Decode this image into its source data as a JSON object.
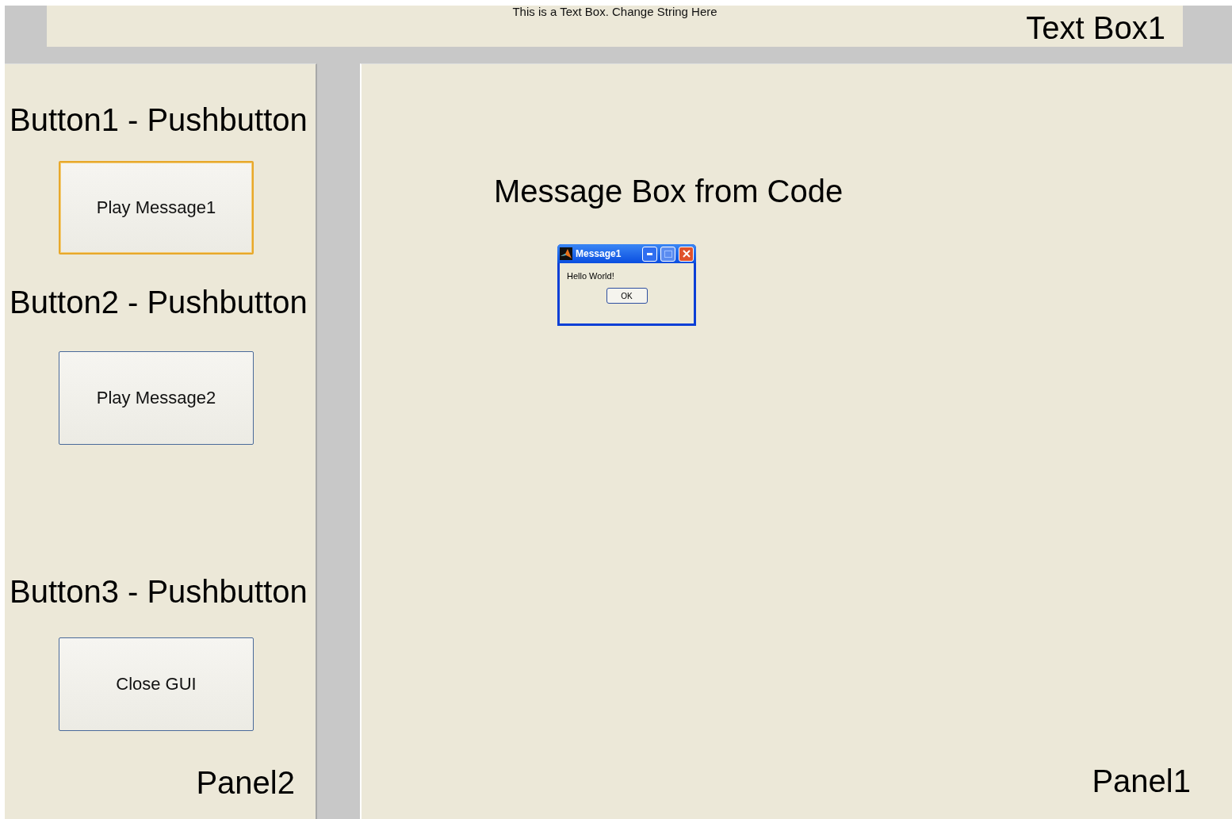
{
  "text_box": {
    "string": "This is a Text Box.  Change String Here",
    "annotation": "Text Box1"
  },
  "left_panel": {
    "annotation": "Panel2",
    "buttons": [
      {
        "annotation": "Button1 - Pushbutton",
        "label": "Play Message1",
        "focused": true
      },
      {
        "annotation": "Button2 - Pushbutton",
        "label": "Play Message2",
        "focused": false
      },
      {
        "annotation": "Button3 - Pushbutton",
        "label": "Close GUI",
        "focused": false
      }
    ]
  },
  "right_panel": {
    "annotation": "Panel1",
    "caption": "Message Box from Code",
    "message_box": {
      "title": "Message1",
      "text": "Hello World!",
      "button": "OK"
    }
  }
}
